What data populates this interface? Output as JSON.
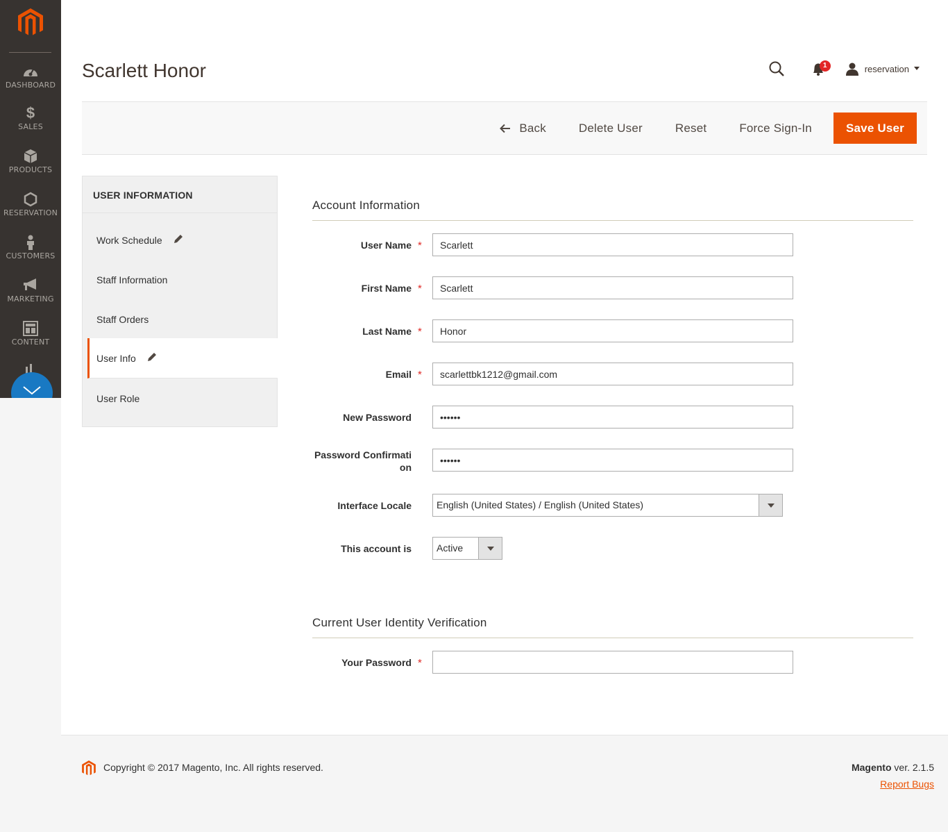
{
  "nav": {
    "items": [
      {
        "label": "DASHBOARD",
        "icon": "dashboard-icon"
      },
      {
        "label": "SALES",
        "icon": "dollar-icon"
      },
      {
        "label": "PRODUCTS",
        "icon": "box-icon"
      },
      {
        "label": "RESERVATION",
        "icon": "hexagon-icon"
      },
      {
        "label": "CUSTOMERS",
        "icon": "person-icon"
      },
      {
        "label": "MARKETING",
        "icon": "megaphone-icon"
      },
      {
        "label": "CONTENT",
        "icon": "layout-icon"
      }
    ]
  },
  "header": {
    "title": "Scarlett Honor",
    "notifications_count": "1",
    "user": "reservation"
  },
  "actions": {
    "back": "Back",
    "delete": "Delete User",
    "reset": "Reset",
    "force_signin": "Force Sign-In",
    "save": "Save User"
  },
  "tabs": {
    "title": "USER INFORMATION",
    "items": [
      {
        "label": "Work Schedule"
      },
      {
        "label": "Staff Information"
      },
      {
        "label": "Staff Orders"
      },
      {
        "label": "User Info"
      },
      {
        "label": "User Role"
      }
    ]
  },
  "account": {
    "title": "Account Information",
    "fields": {
      "username": {
        "label": "User Name",
        "value": "Scarlett"
      },
      "firstname": {
        "label": "First Name",
        "value": "Scarlett"
      },
      "lastname": {
        "label": "Last Name",
        "value": "Honor"
      },
      "email": {
        "label": "Email",
        "value": "scarlettbk1212@gmail.com"
      },
      "password": {
        "label": "New Password",
        "value": "••••••"
      },
      "confirm": {
        "label_1": "Password Confirmati",
        "label_2": "on",
        "value": "••••••"
      },
      "locale": {
        "label": "Interface Locale",
        "value": "English (United States) / English (United States)"
      },
      "status": {
        "label": "This account is",
        "value": "Active"
      }
    }
  },
  "verify": {
    "title": "Current User Identity Verification",
    "password_label": "Your Password",
    "password_value": ""
  },
  "footer": {
    "copyright": "Copyright © 2017 Magento, Inc. All rights reserved.",
    "brand": "Magento",
    "version": " ver. 2.1.5",
    "report": "Report Bugs"
  },
  "colors": {
    "accent": "#eb5202",
    "nav_bg": "#373330",
    "badge": "#e22626",
    "chat": "#1979c3"
  }
}
